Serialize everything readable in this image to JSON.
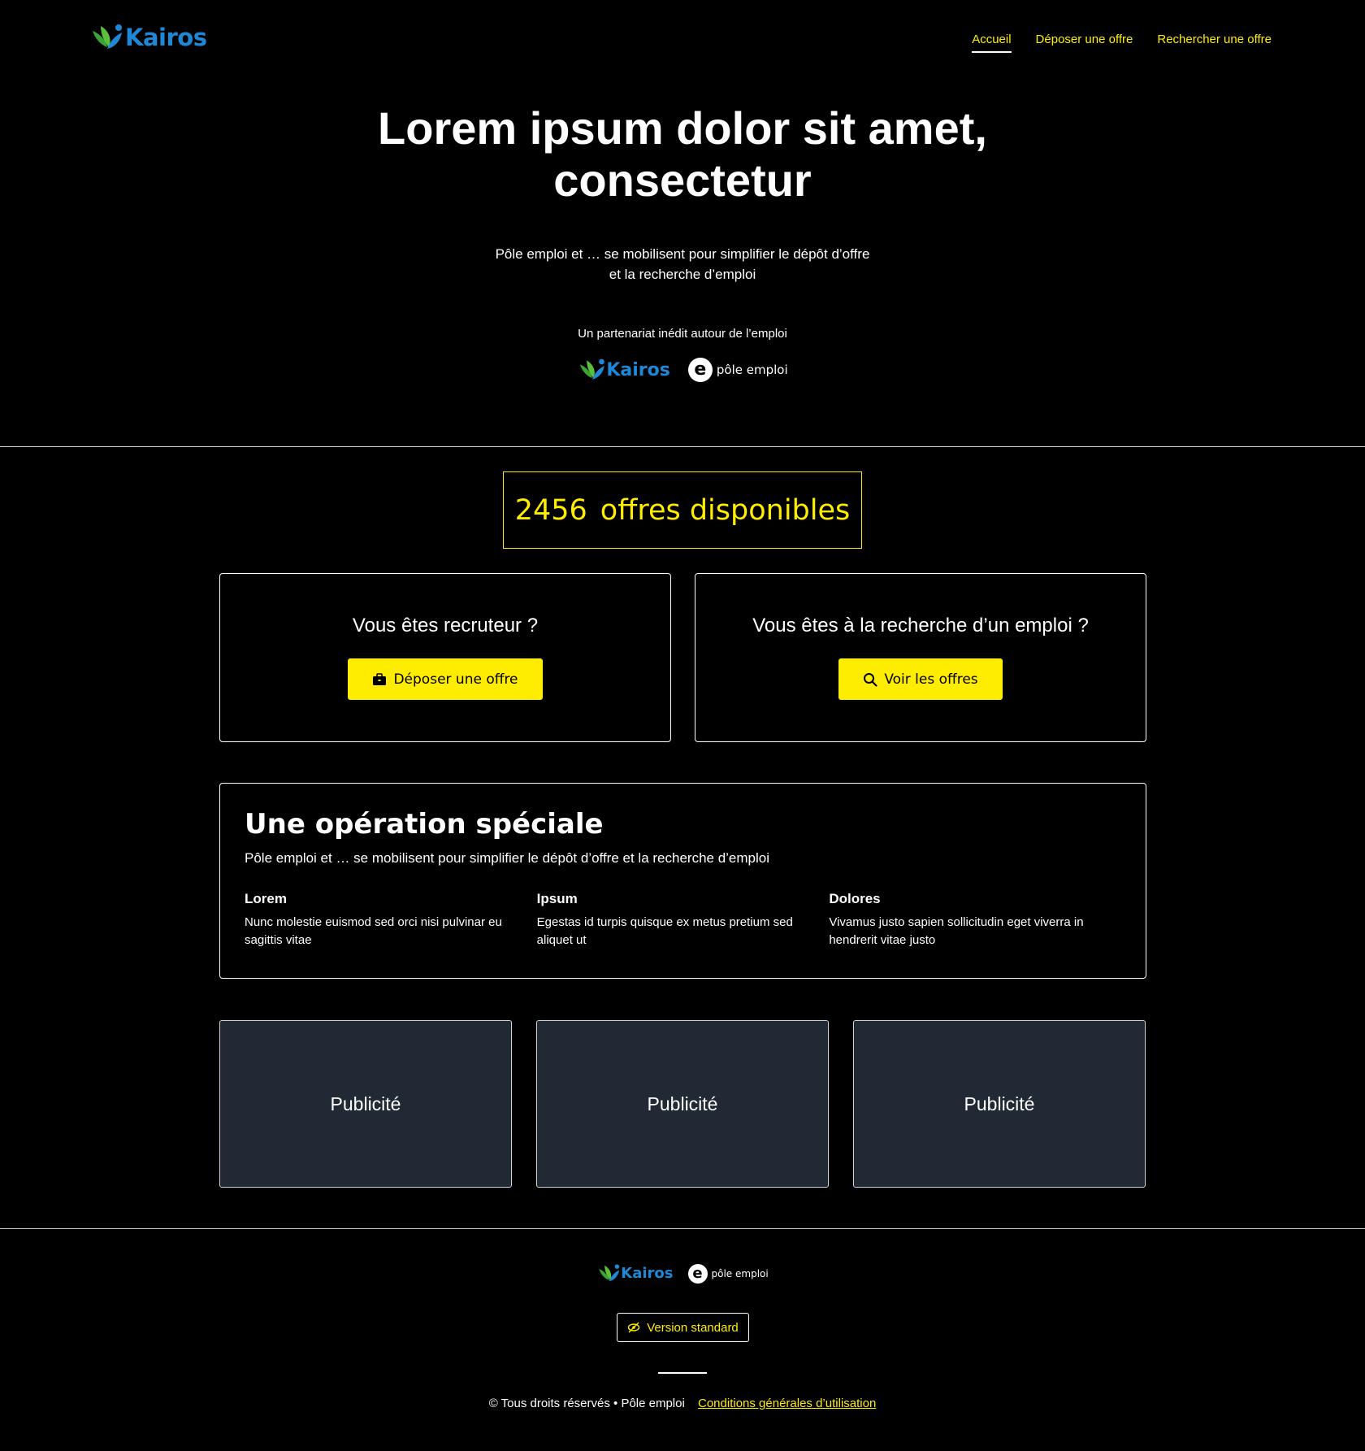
{
  "header": {
    "logo_text": "Kairos",
    "nav": [
      {
        "label": "Accueil",
        "active": true
      },
      {
        "label": "Déposer une offre",
        "active": false
      },
      {
        "label": "Rechercher une offre",
        "active": false
      }
    ]
  },
  "hero": {
    "title_line1": "Lorem ipsum dolor sit amet,",
    "title_line2": "consectetur",
    "subtitle_line1": "Pôle emploi et … se mobilisent pour simplifier le dépôt d’offre",
    "subtitle_line2": "et la recherche d’emploi",
    "partner_label": "Un partenariat inédit autour de l’emploi",
    "partner_logo_kairos": "Kairos",
    "partner_logo_pe": "pôle emploi",
    "partner_logo_pe_mark": "e"
  },
  "counter": {
    "count": "2456",
    "label": "offres disponibles"
  },
  "recruiter": {
    "title": "Vous êtes recruteur ?",
    "button_label": "Déposer une offre",
    "icon": "briefcase-icon"
  },
  "seeker": {
    "title": "Vous êtes à la recherche d’un emploi ?",
    "button_label": "Voir les offres",
    "icon": "search-icon"
  },
  "special": {
    "title": "Une opération spéciale",
    "subtitle": "Pôle emploi et … se mobilisent pour simplifier le dépôt d’offre et la recherche d’emploi",
    "columns": [
      {
        "title": "Lorem",
        "text": "Nunc molestie euismod sed orci nisi pulvinar eu sagittis vitae"
      },
      {
        "title": "Ipsum",
        "text": "Egestas id turpis quisque ex metus pretium sed aliquet ut"
      },
      {
        "title": "Dolores",
        "text": "Vivamus justo sapien sollicitudin eget viverra in hendrerit vitae justo"
      }
    ]
  },
  "ads": [
    "Publicité",
    "Publicité",
    "Publicité"
  ],
  "footer": {
    "logo_kairos": "Kairos",
    "logo_pe": "pôle emploi",
    "logo_pe_mark": "e",
    "version_button": "Version standard",
    "version_icon": "eye-slash-icon",
    "copyright": "© Tous droits réservés • Pôle emploi",
    "terms_link": "Conditions générales d’utilisation"
  },
  "colors": {
    "accent": "#ffed00",
    "background": "#000000",
    "ad_background": "#212a34",
    "kairos_blue": "#1e88d6",
    "kairos_green": "#3aa335"
  }
}
